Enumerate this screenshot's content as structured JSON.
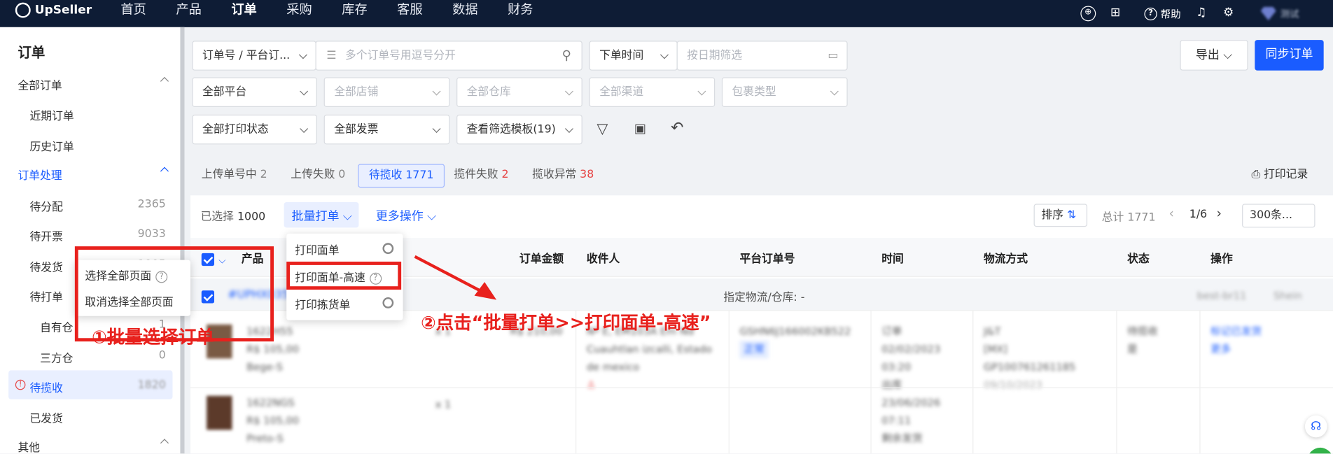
{
  "app": {
    "logo": "UpSeller"
  },
  "nav": [
    "首页",
    "产品",
    "订单",
    "采购",
    "库存",
    "客服",
    "数据",
    "财务"
  ],
  "header": {
    "help": "帮助",
    "username": "测试"
  },
  "sidebar": {
    "title": "订单",
    "all_orders": "全部订单",
    "recent": "近期订单",
    "history": "历史订单",
    "processing": "订单处理",
    "items": [
      {
        "label": "待分配",
        "count": "2365"
      },
      {
        "label": "待开票",
        "count": "9033"
      },
      {
        "label": "待发货",
        "count": "1005"
      },
      {
        "label": "待打单",
        "count": ""
      },
      {
        "label": "自有仓",
        "count": "1"
      },
      {
        "label": "三方仓",
        "count": "0"
      },
      {
        "label": "待揽收",
        "count": "1820"
      },
      {
        "label": "已发货",
        "count": ""
      }
    ],
    "other": "其他"
  },
  "filters": {
    "order_no_type": "订单号 / 平台订...",
    "search_placeholder": "多个订单号用逗号分开",
    "time_type": "下单时间",
    "date_placeholder": "按日期筛选",
    "platform": "全部平台",
    "store": "全部店铺",
    "warehouse": "全部仓库",
    "channel": "全部渠道",
    "pkg_type": "包裹类型",
    "print_status": "全部打印状态",
    "invoice": "全部发票",
    "template": "查看筛选模板(19)"
  },
  "actions": {
    "export": "导出",
    "sync": "同步订单",
    "print_log": "打印记录"
  },
  "tabs": [
    {
      "label": "上传单号中",
      "count": "2"
    },
    {
      "label": "上传失败",
      "count": "0"
    },
    {
      "label": "待揽收",
      "count": "1771"
    },
    {
      "label": "揽件失败",
      "count": "2"
    },
    {
      "label": "揽收异常",
      "count": "38"
    }
  ],
  "toolbar": {
    "selected_label": "已选择",
    "selected_count": "1000",
    "batch_print": "批量打单",
    "more": "更多操作",
    "sort": "排序",
    "total": "总计 1771",
    "page": "1/6",
    "page_size": "300条..."
  },
  "batch_menu": [
    "打印面单",
    "打印面单-高速",
    "打印拣货单"
  ],
  "select_menu": [
    "选择全部页面",
    "取消选择全部页面"
  ],
  "table": {
    "headers": [
      "产品",
      "订单金额",
      "收件人",
      "平台订单号",
      "时间",
      "物流方式",
      "状态",
      "操作"
    ],
    "group_label": "指定物流/仓库: -",
    "group_order": "#UPHX035",
    "group_tags": [
      "best-br11",
      "Shein"
    ],
    "rows": [
      {
        "sku": "1622H55",
        "price": "R$ 105,00",
        "variant": "Bege-S",
        "qty": "x 1",
        "amount": "R$ 210,00",
        "recipient": "Nº E, EM103A Em Nd",
        "addr1": "Cuauhtlan izcalli, Estado",
        "addr2": "de mexico",
        "platform_no": "GSHN6J166002KB522",
        "tag": "正常",
        "time1": "订单",
        "time2": "02/02/2023",
        "time3": "03:20",
        "time4": "出库",
        "time5": "23/06/2026",
        "time6": "07:11",
        "time7": "剩余发货",
        "logistics": "J&T",
        "log2": "[MX]",
        "log3": "GP100761261185",
        "log4": "09/10/2023",
        "status": "待揽收",
        "status2": "是",
        "op1": "标记已发货",
        "op2": "更多"
      },
      {
        "sku": "1622NGS",
        "price": "R$ 105,00",
        "variant": "Preto-S",
        "qty": "x 1"
      }
    ]
  },
  "annotations": {
    "step1": "①批量选择订单",
    "step2": "②点击“批量打单>>打印面单-高速”"
  },
  "colors": {
    "primary": "#1a5cff",
    "annotation": "#e8211d",
    "topbar": "#0e1c35"
  }
}
